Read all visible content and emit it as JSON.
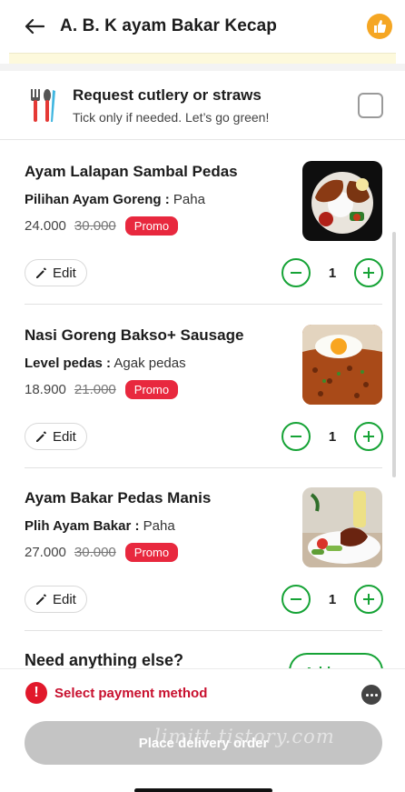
{
  "header": {
    "title": "A. B. K ayam Bakar Kecap"
  },
  "cutlery": {
    "title": "Request cutlery or straws",
    "subtitle": "Tick only if needed. Let’s go green!"
  },
  "items": [
    {
      "name": "Ayam Lalapan Sambal Pedas",
      "option_label": "Pilihan Ayam Goreng :",
      "option_value": "Paha",
      "price": "24.000",
      "old_price": "30.000",
      "promo": "Promo",
      "edit": "Edit",
      "qty": "1"
    },
    {
      "name": "Nasi Goreng Bakso+ Sausage",
      "option_label": "Level pedas :",
      "option_value": "Agak pedas",
      "price": "18.900",
      "old_price": "21.000",
      "promo": "Promo",
      "edit": "Edit",
      "qty": "1"
    },
    {
      "name": "Ayam Bakar Pedas Manis",
      "option_label": "Plih Ayam Bakar :",
      "option_value": "Paha",
      "price": "27.000",
      "old_price": "30.000",
      "promo": "Promo",
      "edit": "Edit",
      "qty": "1"
    }
  ],
  "need_more": {
    "title": "Need anything else?",
    "button": "Add more"
  },
  "footer": {
    "payment": "Select payment method",
    "order_button": "Place delivery order",
    "watermark": "limitt.tistory.com"
  },
  "colors": {
    "accent_green": "#16a336",
    "promo_red": "#e8283e",
    "alert_red": "#c8102e",
    "thumb_orange": "#f5a623"
  }
}
